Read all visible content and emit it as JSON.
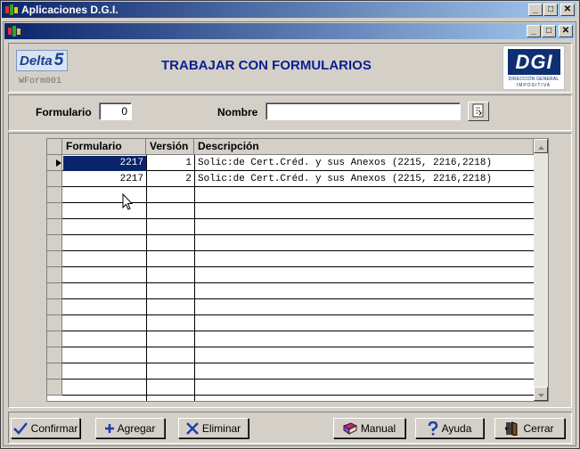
{
  "outer_window": {
    "title": "Aplicaciones  D.G.I."
  },
  "inner_window": {
    "title": ""
  },
  "header": {
    "delta_logo_text": "Delta",
    "delta_logo_number": "5",
    "form_code": "WForm001",
    "title": "TRABAJAR CON FORMULARIOS",
    "dgi_logo_mark": "DGI",
    "dgi_logo_line1": "DIRECCIÓN GENERAL",
    "dgi_logo_line2": "IMPOSITIVA"
  },
  "filters": {
    "formulario_label": "Formulario",
    "formulario_value": "0",
    "nombre_label": "Nombre",
    "nombre_value": ""
  },
  "grid": {
    "columns": [
      "Formulario",
      "Versión",
      "Descripción"
    ],
    "rows": [
      {
        "formulario": "2217",
        "version": "1",
        "descripcion": "Solic:de Cert.Créd. y sus Anexos (2215, 2216,2218)",
        "selected": true
      },
      {
        "formulario": "2217",
        "version": "2",
        "descripcion": "Solic:de Cert.Créd. y sus Anexos (2215, 2216,2218)",
        "selected": false
      }
    ],
    "empty_rows": 13
  },
  "buttons": {
    "confirmar": "Confirmar",
    "agregar": "Agregar",
    "eliminar": "Eliminar",
    "manual": "Manual",
    "ayuda": "Ayuda",
    "cerrar": "Cerrar"
  },
  "colors": {
    "titlebar_start": "#0a246a",
    "titlebar_end": "#a6caf0",
    "page_title": "#0a1f8f",
    "selection": "#0a246a",
    "window_face": "#d4d0c8"
  },
  "icons": {
    "app": "app-logo-icon",
    "minimize": "minimize-icon",
    "maximize": "maximize-icon",
    "close": "close-icon",
    "search": "lookup-icon",
    "confirmar": "check-icon",
    "agregar": "plus-icon",
    "eliminar": "x-icon",
    "manual": "book-icon",
    "ayuda": "question-icon",
    "cerrar": "exit-door-icon"
  }
}
